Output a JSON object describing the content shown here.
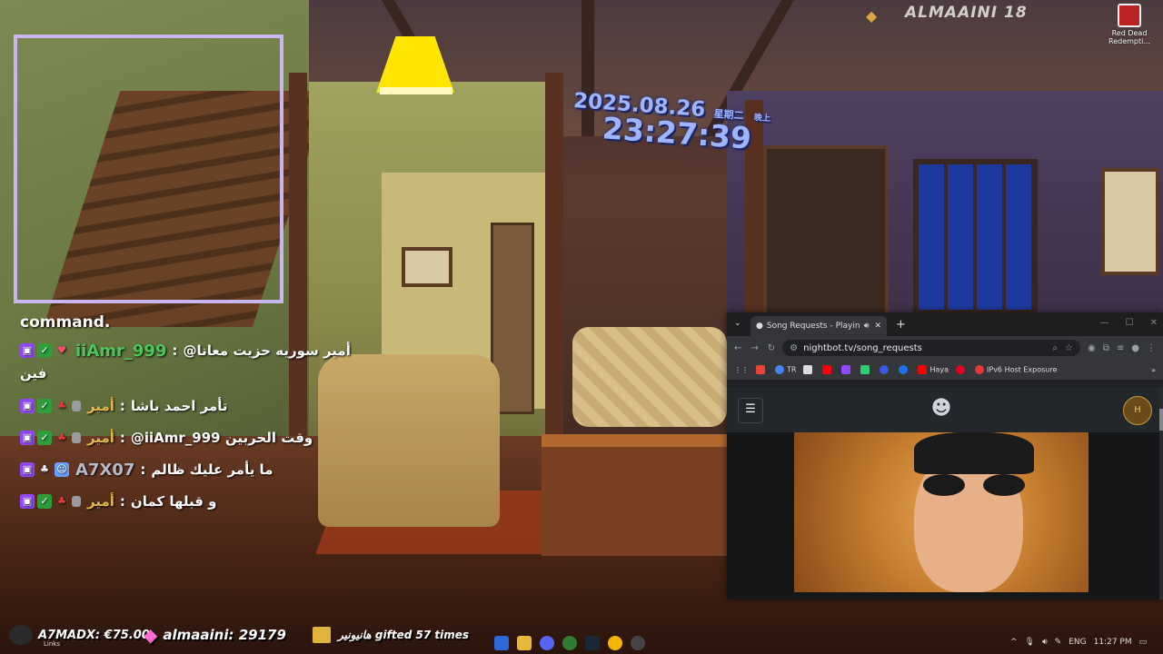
{
  "overlay": {
    "brand": "ALMAAINI 18",
    "clock": {
      "date": "2025.08.26",
      "day_of_week": "星期二",
      "ampm": "晚上",
      "time": "23:27:39"
    }
  },
  "desktop_icon": {
    "label": "Red Dead Redempti..."
  },
  "chat": {
    "command_text": "command.",
    "messages": [
      {
        "user": "iiAmr_999",
        "separator": ":",
        "text": "@أمير سوريه حزيت معانا",
        "continuation": "فين",
        "user_color": "#4cc85a"
      },
      {
        "user": "أمير",
        "separator": ":",
        "text": "تأمر احمد باشا",
        "user_color": "#e4b846"
      },
      {
        "user": "أمير",
        "separator": ":",
        "text": "@iiAmr_999 وقت الحربين",
        "user_color": "#e4b846"
      },
      {
        "user": "A7X07",
        "separator": ":",
        "text": "ما يأمر عليك ظالم",
        "user_color": "#b7b9c7"
      },
      {
        "user": "أمير",
        "separator": ":",
        "text": "و قبلها كمان",
        "user_color": "#e4b846"
      }
    ]
  },
  "browser": {
    "tab_title": "Song Requests - Playing a...",
    "url": "nightbot.tv/song_requests",
    "bookmarks": [
      "TR",
      "Haya",
      "IPv6 Host Exposure"
    ],
    "new_tab_label": "+"
  },
  "alerts": {
    "donation": "A7MADX: €75.00",
    "bits": "almaaini: 29179",
    "gift": "هانيونير gifted 57 times",
    "links_label": "Links"
  },
  "taskbar": {
    "language": "ENG",
    "time": "11:27 PM"
  },
  "colors": {
    "webcam_border": "#c9b6f0",
    "clock": "#9fb4ff",
    "twitch": "#9146ff"
  }
}
